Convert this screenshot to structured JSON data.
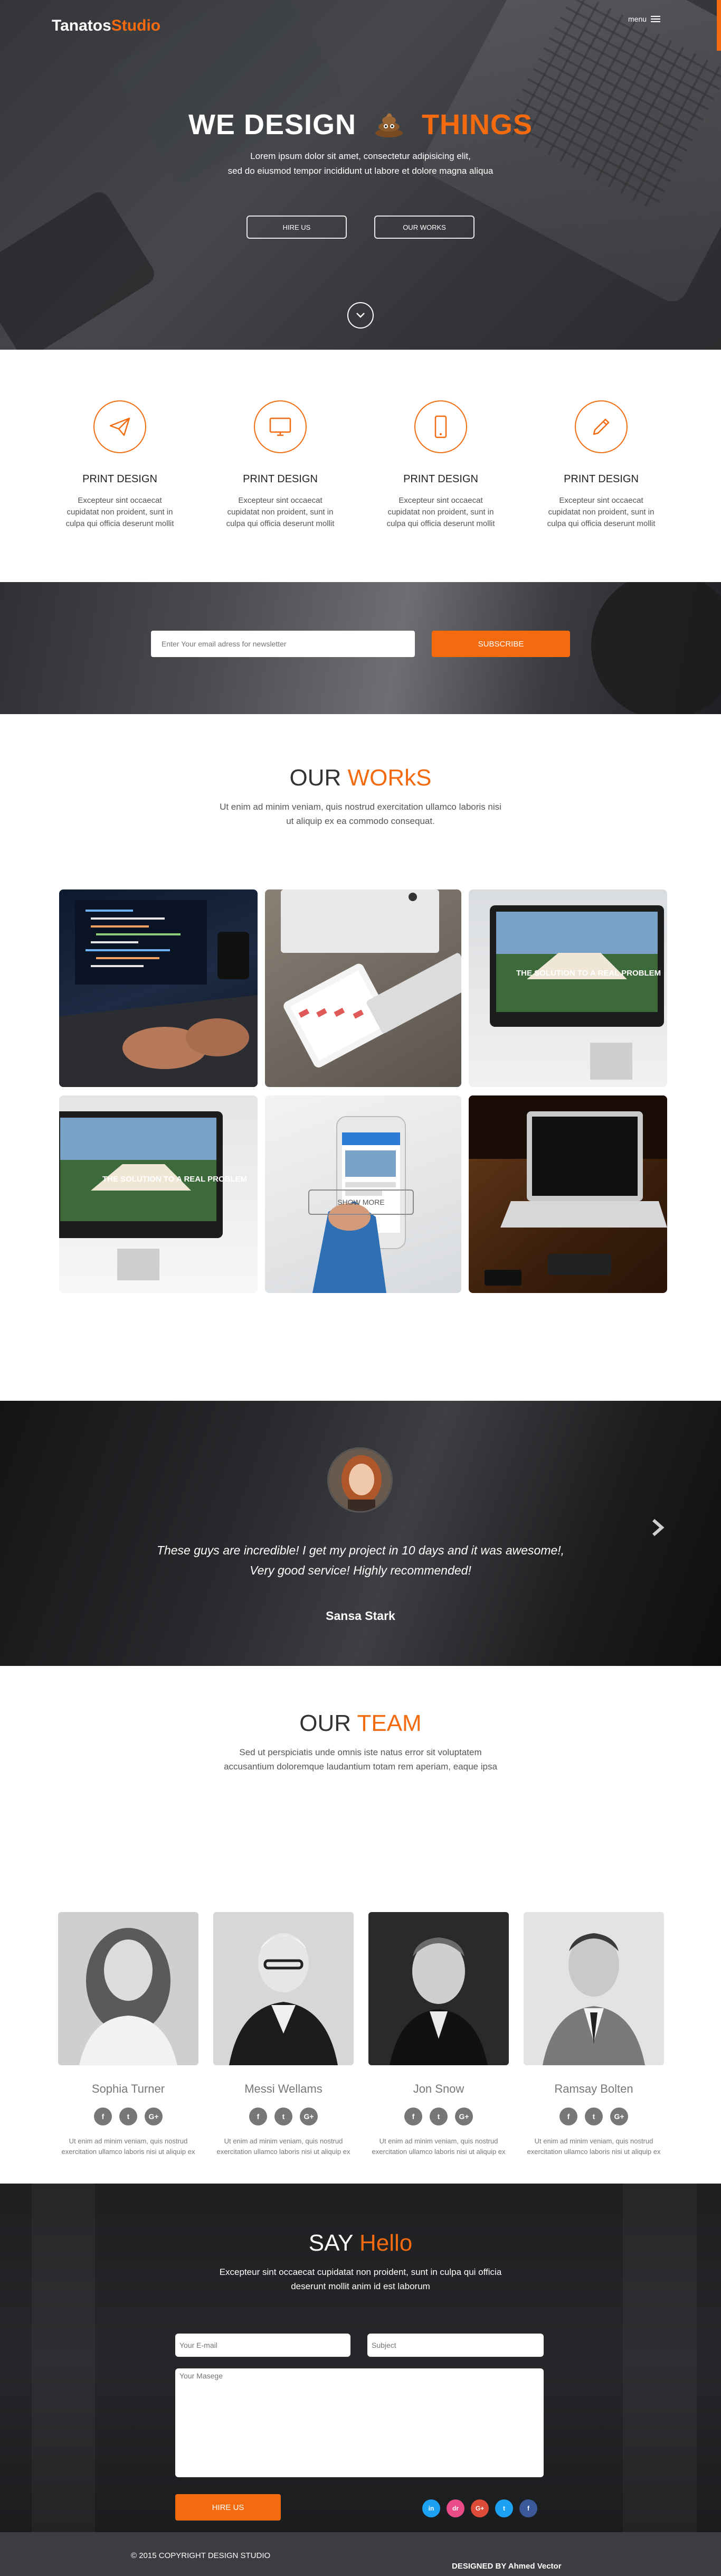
{
  "header": {
    "brand_part1": "Tanatos",
    "brand_part2": "Studio",
    "menu_label": "menu"
  },
  "hero": {
    "title_left": "WE DESIGN",
    "title_right": "THINGS",
    "subtitle_line1": "Lorem ipsum dolor sit amet, consectetur adipisicing elit,",
    "subtitle_line2": "sed do eiusmod tempor incididunt ut labore et dolore magna aliqua",
    "hire_label": "HIRE US",
    "works_label": "OUR WORKS"
  },
  "services": [
    {
      "icon": "paper-plane-icon",
      "title": "PRINT DESIGN",
      "text_line1": "Excepteur sint occaecat",
      "text_line2": "cupidatat non proident, sunt in",
      "text_line3": "culpa qui officia deserunt mollit"
    },
    {
      "icon": "monitor-icon",
      "title": "PRINT DESIGN",
      "text_line1": "Excepteur sint occaecat",
      "text_line2": "cupidatat non proident, sunt in",
      "text_line3": "culpa qui officia deserunt mollit"
    },
    {
      "icon": "mobile-icon",
      "title": "PRINT DESIGN",
      "text_line1": "Excepteur sint occaecat",
      "text_line2": "cupidatat non proident, sunt in",
      "text_line3": "culpa qui officia deserunt mollit"
    },
    {
      "icon": "pencil-icon",
      "title": "PRINT DESIGN",
      "text_line1": "Excepteur sint occaecat",
      "text_line2": "cupidatat non proident, sunt in",
      "text_line3": "culpa qui officia deserunt mollit"
    }
  ],
  "newsletter": {
    "placeholder": "Enter Your email adress for newsletter",
    "button": "SUBSCRIBE"
  },
  "works": {
    "title_plain": "OUR",
    "title_accent": "WORkS",
    "sub_line1": "Ut enim ad minim veniam, quis nostrud exercitation ullamco laboris nisi",
    "sub_line2": "ut aliquip ex ea commodo consequat.",
    "tile_caption": "THE SOLUTION TO A REAL PROBLEM",
    "show_more": "SHOW MORE"
  },
  "testimonial": {
    "quote_line1": "These guys are incredible! I get my project in 10 days and it was awesome!,",
    "quote_line2": "Very good service! Highly recommended!",
    "name": "Sansa Stark"
  },
  "team": {
    "title_plain": "OUR",
    "title_accent": "TEAM",
    "sub_line1": "Sed ut perspiciatis unde omnis iste natus error sit voluptatem",
    "sub_line2": "accusantium doloremque laudantium totam rem aperiam, eaque ipsa",
    "members": [
      {
        "name": "Sophia Turner",
        "bio_line1": "Ut enim ad minim veniam, quis nostrud",
        "bio_line2": "exercitation ullamco laboris nisi ut aliquip ex"
      },
      {
        "name": "Messi Wellams",
        "bio_line1": "Ut enim ad minim veniam, quis nostrud",
        "bio_line2": "exercitation ullamco laboris nisi ut aliquip ex"
      },
      {
        "name": "Jon Snow",
        "bio_line1": "Ut enim ad minim veniam, quis nostrud",
        "bio_line2": "exercitation ullamco laboris nisi ut aliquip ex"
      },
      {
        "name": "Ramsay Bolten",
        "bio_line1": "Ut enim ad minim veniam, quis nostrud",
        "bio_line2": "exercitation ullamco laboris nisi ut aliquip ex"
      }
    ],
    "social_glyphs": {
      "facebook": "f",
      "twitter": "t",
      "google": "G+"
    }
  },
  "contact": {
    "title_plain": "SAY",
    "title_accent": "Hello",
    "sub_line1": "Excepteur sint occaecat cupidatat non proident, sunt in culpa qui officia",
    "sub_line2": "deserunt mollit anim id est laborum",
    "email_placeholder": "Your E-mail",
    "subject_placeholder": "Subject",
    "message_placeholder": "Your Masege",
    "hire_label": "HIRE US",
    "socials": [
      {
        "icon": "instagram-icon",
        "glyph": "in",
        "color": "#1da1f2"
      },
      {
        "icon": "dribbble-icon",
        "glyph": "dr",
        "color": "#ea4c89"
      },
      {
        "icon": "google-plus-icon",
        "glyph": "G+",
        "color": "#dd4b39"
      },
      {
        "icon": "twitter-icon",
        "glyph": "t",
        "color": "#1da1f2"
      },
      {
        "icon": "facebook-icon",
        "glyph": "f",
        "color": "#3b5998"
      }
    ]
  },
  "footer": {
    "copyright": "© 2015 COPYRIGHT DESIGN STUDIO",
    "designed_by": "DESIGNED BY Ahmed Vector"
  },
  "colors": {
    "accent": "#f46b0f",
    "dark": "#3c3d40"
  }
}
